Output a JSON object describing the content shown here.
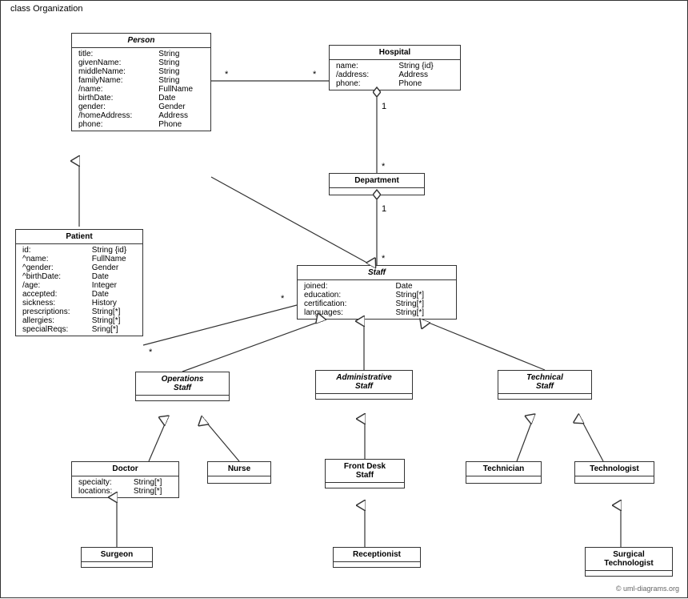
{
  "diagram": {
    "title": "class Organization",
    "classes": {
      "person": {
        "name": "Person",
        "italic": true,
        "fields": [
          [
            "title:",
            "String"
          ],
          [
            "givenName:",
            "String"
          ],
          [
            "middleName:",
            "String"
          ],
          [
            "familyName:",
            "String"
          ],
          [
            "/name:",
            "FullName"
          ],
          [
            "birthDate:",
            "Date"
          ],
          [
            "gender:",
            "Gender"
          ],
          [
            "/homeAddress:",
            "Address"
          ],
          [
            "phone:",
            "Phone"
          ]
        ]
      },
      "hospital": {
        "name": "Hospital",
        "italic": false,
        "fields": [
          [
            "name:",
            "String {id}"
          ],
          [
            "/address:",
            "Address"
          ],
          [
            "phone:",
            "Phone"
          ]
        ]
      },
      "patient": {
        "name": "Patient",
        "italic": false,
        "fields": [
          [
            "id:",
            "String {id}"
          ],
          [
            "^name:",
            "FullName"
          ],
          [
            "^gender:",
            "Gender"
          ],
          [
            "^birthDate:",
            "Date"
          ],
          [
            "/age:",
            "Integer"
          ],
          [
            "accepted:",
            "Date"
          ],
          [
            "sickness:",
            "History"
          ],
          [
            "prescriptions:",
            "String[*]"
          ],
          [
            "allergies:",
            "String[*]"
          ],
          [
            "specialReqs:",
            "Sring[*]"
          ]
        ]
      },
      "department": {
        "name": "Department",
        "italic": false,
        "fields": []
      },
      "staff": {
        "name": "Staff",
        "italic": true,
        "fields": [
          [
            "joined:",
            "Date"
          ],
          [
            "education:",
            "String[*]"
          ],
          [
            "certification:",
            "String[*]"
          ],
          [
            "languages:",
            "String[*]"
          ]
        ]
      },
      "operations_staff": {
        "name": "Operations Staff",
        "italic": true,
        "fields": []
      },
      "administrative_staff": {
        "name": "Administrative Staff",
        "italic": true,
        "fields": []
      },
      "technical_staff": {
        "name": "Technical Staff",
        "italic": true,
        "fields": []
      },
      "doctor": {
        "name": "Doctor",
        "italic": false,
        "fields": [
          [
            "specialty:",
            "String[*]"
          ],
          [
            "locations:",
            "String[*]"
          ]
        ]
      },
      "nurse": {
        "name": "Nurse",
        "italic": false,
        "fields": []
      },
      "front_desk_staff": {
        "name": "Front Desk Staff",
        "italic": false,
        "fields": []
      },
      "technician": {
        "name": "Technician",
        "italic": false,
        "fields": []
      },
      "technologist": {
        "name": "Technologist",
        "italic": false,
        "fields": []
      },
      "surgeon": {
        "name": "Surgeon",
        "italic": false,
        "fields": []
      },
      "receptionist": {
        "name": "Receptionist",
        "italic": false,
        "fields": []
      },
      "surgical_technologist": {
        "name": "Surgical Technologist",
        "italic": false,
        "fields": []
      }
    },
    "multiplicity_labels": {
      "star1": "*",
      "one1": "1",
      "star2": "*",
      "one2": "1",
      "star3": "*",
      "star4": "*"
    },
    "copyright": "© uml-diagrams.org"
  }
}
